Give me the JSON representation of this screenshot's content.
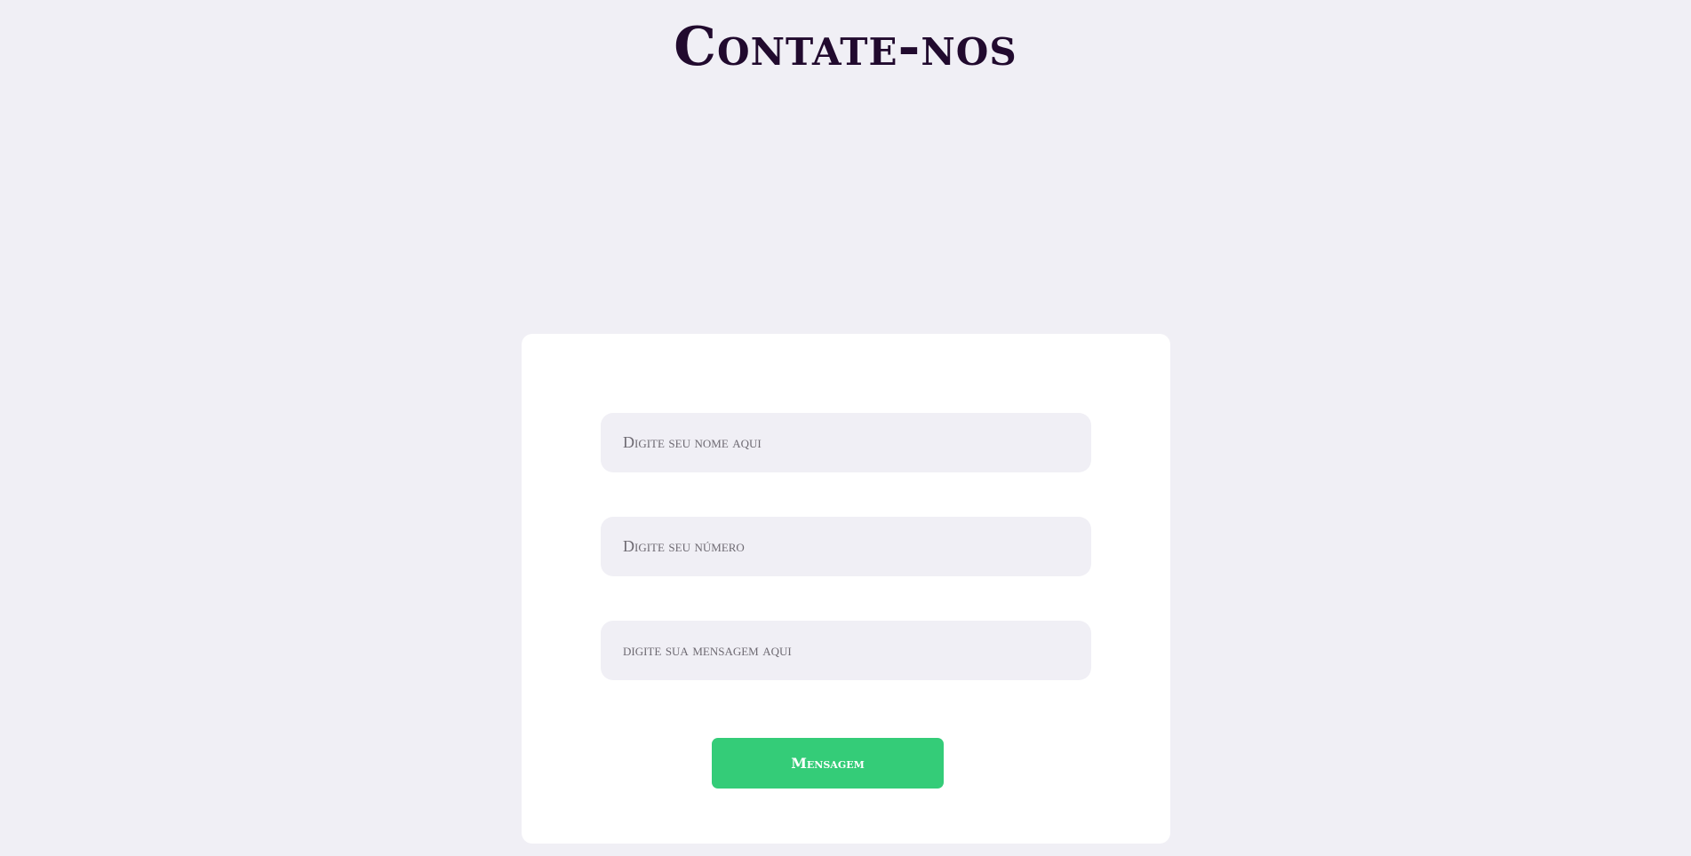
{
  "page": {
    "title": "Contate-nos"
  },
  "form": {
    "name_field": {
      "value": "",
      "placeholder": "Digite seu nome aqui"
    },
    "number_field": {
      "value": "",
      "placeholder": "Digite seu número"
    },
    "message_field": {
      "value": "",
      "placeholder": "digite sua mensagem aqui"
    },
    "submit_label": "Mensagem"
  },
  "colors": {
    "background": "#f0eff5",
    "card": "#ffffff",
    "title": "#210a2e",
    "button": "#34cc78",
    "button_text": "#ffffff"
  }
}
